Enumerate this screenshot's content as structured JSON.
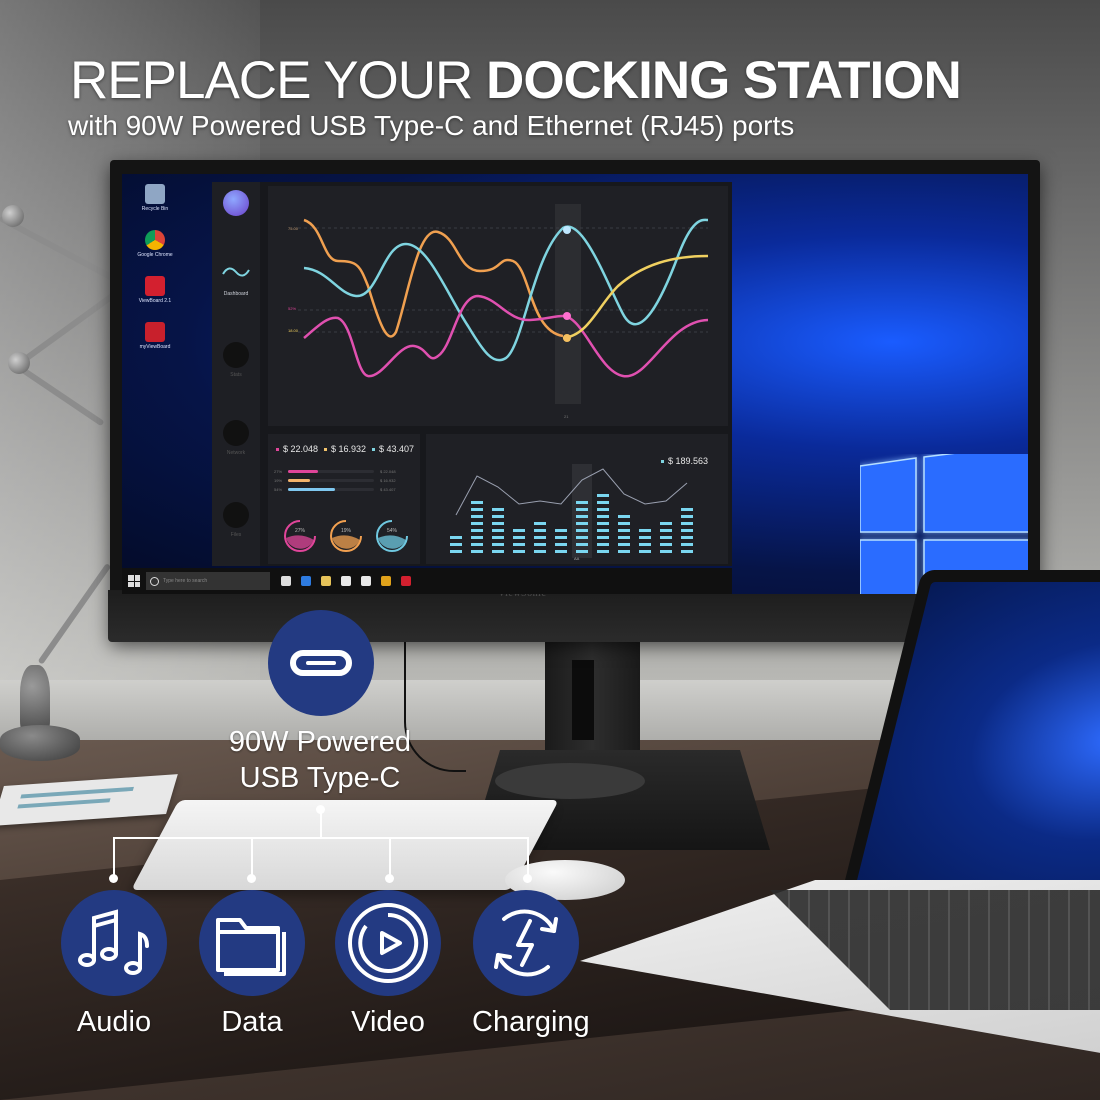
{
  "headline": {
    "prefix": "REPLACE YOUR ",
    "emphasis": "DOCKING STATION",
    "subtitle": "with 90W Powered USB Type-C and Ethernet (RJ45) ports"
  },
  "monitor": {
    "brand": "ViewSonic",
    "desktop_icons": [
      {
        "label": "Recycle Bin",
        "icon": "recycle-bin-icon",
        "color": "#8fa6c4"
      },
      {
        "label": "Google Chrome",
        "icon": "chrome-icon",
        "color": "#e0a21b"
      },
      {
        "label": "ViewBoard 2.1",
        "icon": "viewboard-icon",
        "color": "#d3202f"
      },
      {
        "label": "myViewBoard",
        "icon": "myviewboard-icon",
        "color": "#c8202c"
      }
    ],
    "taskbar": {
      "search_placeholder": "Type here to search",
      "apps": [
        {
          "icon": "task-view-icon",
          "color": "#dddddd"
        },
        {
          "icon": "edge-icon",
          "color": "#2e7be0"
        },
        {
          "icon": "file-explorer-icon",
          "color": "#e6c35a"
        },
        {
          "icon": "store-icon",
          "color": "#e8e8e8"
        },
        {
          "icon": "mail-icon",
          "color": "#e8e8e8"
        },
        {
          "icon": "chrome-icon",
          "color": "#e0a21b"
        },
        {
          "icon": "myviewboard-icon",
          "color": "#d3202f"
        }
      ]
    },
    "dashboard_app": {
      "sidebar": [
        {
          "label": "",
          "icon": "profile-orb-icon"
        },
        {
          "label": "Dashboard",
          "icon": "wave-icon"
        },
        {
          "label": "Stats",
          "icon": "circle-icon"
        },
        {
          "label": "Network",
          "icon": "circle-icon"
        },
        {
          "label": "Files",
          "icon": "circle-icon"
        }
      ],
      "line_chart": {
        "y_labels": [
          "75.00",
          "52%",
          "18.00"
        ],
        "highlight_x_label": "21",
        "series_colors": [
          "#f0a050",
          "#7fd4e0",
          "#e050b0",
          "#f0d060"
        ]
      },
      "summary": {
        "values": [
          {
            "label": "$ 22.048",
            "color": "#e0459a"
          },
          {
            "label": "$ 16.932",
            "color": "#f2c36b"
          },
          {
            "label": "$ 43.407",
            "color": "#7fd4e0"
          }
        ],
        "bars": [
          {
            "pct_label": "27%",
            "fraction": 0.35,
            "color": "#e0459a",
            "value": "$ 22.048"
          },
          {
            "pct_label": "19%",
            "fraction": 0.25,
            "color": "#f2b36b",
            "value": "$ 16.932"
          },
          {
            "pct_label": "54%",
            "fraction": 0.55,
            "color": "#7fc8f0",
            "value": "$ 43.407"
          }
        ],
        "donuts": [
          {
            "label": "27%",
            "color": "#e0459a"
          },
          {
            "label": "19%",
            "color": "#f2a050"
          },
          {
            "label": "54%",
            "color": "#6fc8e0"
          }
        ]
      },
      "equalizer": {
        "total": "$ 189.563",
        "highlight_x_label": "AA",
        "levels": [
          3,
          8,
          7,
          4,
          5,
          4,
          8,
          9,
          6,
          4,
          5,
          7
        ]
      }
    }
  },
  "callout": {
    "port_label_line1": "90W Powered",
    "port_label_line2": "USB Type-C",
    "port_icon": "usb-c-icon",
    "accent": "#233a82"
  },
  "features": [
    {
      "label": "Audio",
      "icon": "music-notes-icon"
    },
    {
      "label": "Data",
      "icon": "folder-icon"
    },
    {
      "label": "Video",
      "icon": "play-circle-icon"
    },
    {
      "label": "Charging",
      "icon": "charging-cycle-icon"
    }
  ]
}
